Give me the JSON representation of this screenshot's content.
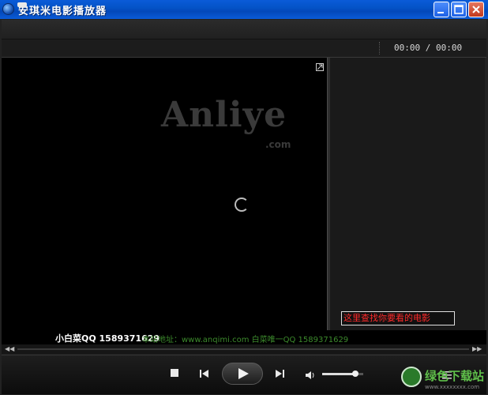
{
  "window": {
    "title": "安琪米电影播放器"
  },
  "time_display": "00:00 / 00:00",
  "video": {
    "logo_text": "Anliye",
    "logo_suffix": ".com"
  },
  "sidepanel": {
    "search_placeholder": "这里查找你要看的电影"
  },
  "marquee": {
    "qq_text": "小白菜QQ 1589371629",
    "site_text": "本站地址：www.anqimi.com 白菜唯一QQ 1589371629"
  },
  "progress": {
    "seek_fraction": 0.0,
    "volume_fraction": 0.8
  },
  "watermark": {
    "text": "绿色下载站",
    "url": "www.xxxxxxxx.com"
  },
  "colors": {
    "title_bar": "#0a5bd8",
    "search_text": "#ff2a2a",
    "marquee_site": "#3c8a2c",
    "watermark_green": "#5fbf4a"
  },
  "icons": {
    "app": "app-logo-icon",
    "minimize": "minimize-icon",
    "maximize": "maximize-icon",
    "close": "close-icon",
    "fullscreen": "fullscreen-icon",
    "loading": "loading-spinner-icon",
    "stop": "stop-icon",
    "previous": "previous-icon",
    "play": "play-icon",
    "next": "next-icon",
    "volume": "speaker-icon",
    "playlist": "playlist-icon"
  }
}
